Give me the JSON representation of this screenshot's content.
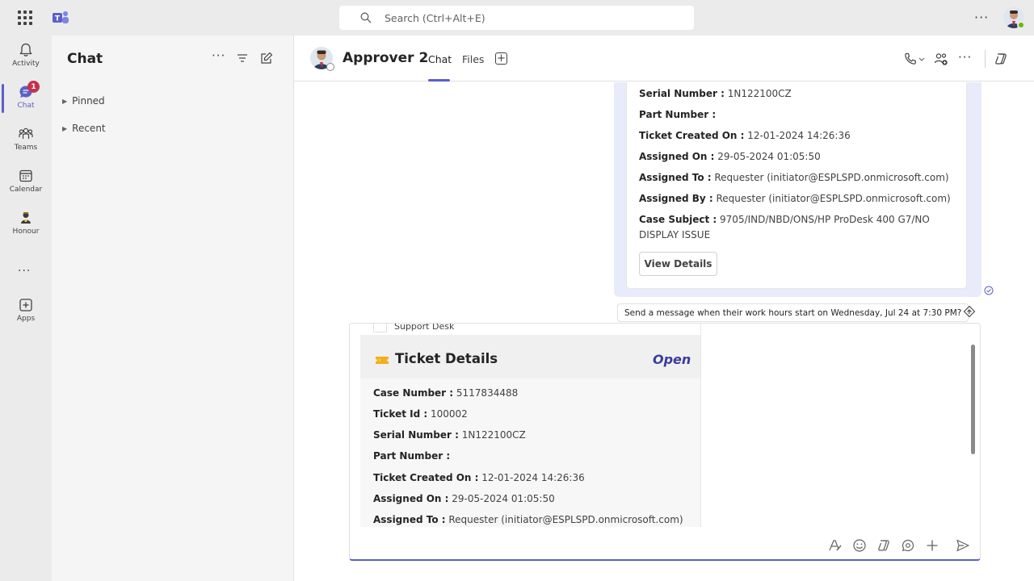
{
  "topbar": {
    "search_placeholder": "Search (Ctrl+Alt+E)",
    "icons": [
      "apps-waffle-icon",
      "teams-logo-icon",
      "search-icon",
      "more-icon",
      "avatar"
    ]
  },
  "rail": {
    "items": [
      {
        "label": "Activity",
        "icon": "bell-icon"
      },
      {
        "label": "Chat",
        "icon": "chat-icon",
        "badge": "1"
      },
      {
        "label": "Teams",
        "icon": "teams-icon"
      },
      {
        "label": "Calendar",
        "icon": "calendar-icon"
      },
      {
        "label": "Honour",
        "icon": "honour-icon"
      },
      {
        "label": "Apps",
        "icon": "add-app-icon"
      }
    ]
  },
  "chatlist": {
    "title": "Chat",
    "sections": [
      {
        "label": "Pinned"
      },
      {
        "label": "Recent"
      }
    ]
  },
  "conversation": {
    "name": "Approver 2",
    "tabs": [
      {
        "label": "Chat",
        "active": true
      },
      {
        "label": "Files",
        "active": false
      }
    ]
  },
  "message_card": {
    "fields": [
      {
        "key": "Serial Number :",
        "value": " 1N122100CZ"
      },
      {
        "key": "Part Number :",
        "value": ""
      },
      {
        "key": "Ticket Created On :",
        "value": " 12-01-2024 14:26:36"
      },
      {
        "key": "Assigned On :",
        "value": " 29-05-2024 01:05:50"
      },
      {
        "key": "Assigned To :",
        "value": " Requester (initiator@ESPLSPD.onmicrosoft.com)"
      },
      {
        "key": "Assigned By :",
        "value": " Requester (initiator@ESPLSPD.onmicrosoft.com)"
      },
      {
        "key": "Case Subject :",
        "value": " 9705/IND/NBD/ONS/HP ProDesk 400 G7/NO DISPLAY ISSUE"
      }
    ],
    "button": "View Details"
  },
  "schedule_hint": "Send a message when their work hours start on Wednesday, Jul 24 at 7:30 PM?",
  "compose_card": {
    "support_label": "Support Desk",
    "title": "Ticket Details",
    "status": "Open",
    "fields": [
      {
        "key": "Case Number :",
        "value": " 5117834488"
      },
      {
        "key": "Ticket Id :",
        "value": " 100002"
      },
      {
        "key": "Serial Number :",
        "value": " 1N122100CZ"
      },
      {
        "key": "Part Number :",
        "value": ""
      },
      {
        "key": "Ticket Created On :",
        "value": " 12-01-2024 14:26:36"
      },
      {
        "key": "Assigned On :",
        "value": " 29-05-2024 01:05:50"
      },
      {
        "key": "Assigned To :",
        "value": " Requester (initiator@ESPLSPD.onmicrosoft.com)"
      }
    ]
  },
  "colors": {
    "accent": "#5b5fc7",
    "badge": "#c4314b",
    "bubble": "#e8ebfa",
    "status_open": "#3b3ba0"
  }
}
